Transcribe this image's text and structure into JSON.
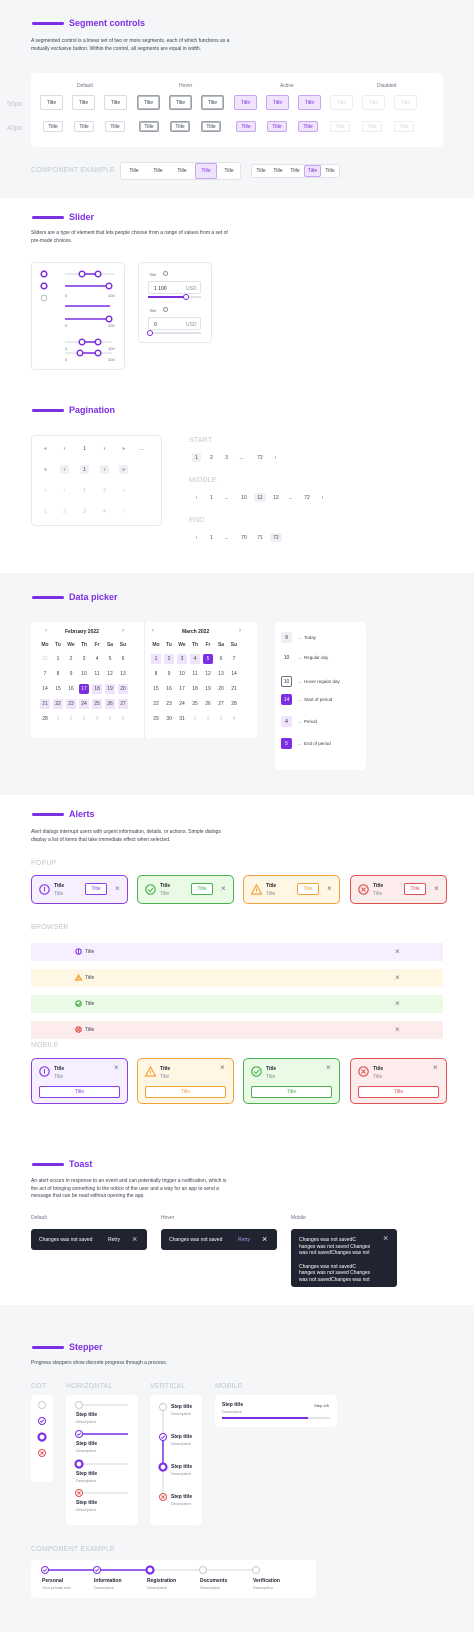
{
  "segment": {
    "title": "Segment controls",
    "desc": "A segmented control is a linear set of two or more segments, each of which functions as a mutually exclusive button. Within the control, all segments are equal in width.",
    "states": [
      "Default",
      "Hover",
      "Active",
      "Disabled"
    ],
    "sizes": [
      "56px",
      "40px"
    ],
    "item": "Title",
    "example_label": "COMPONENT EXAMPLE"
  },
  "slider": {
    "title": "Slider",
    "desc": "Sliders are a type of element that lets people choose from a range of values from a set of pre-made choices.",
    "min": "0",
    "max": "100",
    "field_label": "Title",
    "value1": "1 100",
    "value2": "0",
    "unit": "USD",
    "fill1": 0.72,
    "fill2": 0.0
  },
  "pagination": {
    "title": "Pagination",
    "first": "«",
    "prev": "‹",
    "next": "›",
    "last": "»",
    "dots": "…",
    "labels": [
      "START",
      "MIDDLE",
      "END"
    ],
    "start": [
      "1",
      "2",
      "3",
      "...",
      "72"
    ],
    "middle": [
      "1",
      "...",
      "10",
      "11",
      "12",
      "...",
      "72"
    ],
    "end": [
      "1",
      "...",
      "70",
      "71",
      "72"
    ],
    "card_rows": [
      [
        "1"
      ],
      [
        "1"
      ],
      [
        "1",
        "2",
        "3",
        "4"
      ],
      [
        "1",
        "2",
        "3",
        "4"
      ]
    ]
  },
  "datepicker": {
    "title": "Data picker",
    "month1": "February 2022",
    "month2": "March 2022",
    "weekdays": [
      "Mo",
      "Tu",
      "We",
      "Th",
      "Fr",
      "Sa",
      "Su"
    ],
    "feb": [
      [
        "31",
        "1",
        "2",
        "3",
        "4",
        "5",
        "6"
      ],
      [
        "7",
        "8",
        "9",
        "10",
        "11",
        "12",
        "13"
      ],
      [
        "14",
        "15",
        "16",
        "17",
        "18",
        "19",
        "20"
      ],
      [
        "21",
        "22",
        "23",
        "24",
        "25",
        "26",
        "27"
      ],
      [
        "28",
        "1",
        "2",
        "3",
        "4",
        "5",
        "6"
      ]
    ],
    "mar": [
      [
        "1",
        "2",
        "3",
        "4",
        "5",
        "6",
        "7"
      ],
      [
        "8",
        "9",
        "10",
        "11",
        "12",
        "13",
        "14"
      ],
      [
        "15",
        "16",
        "17",
        "18",
        "19",
        "20",
        "21"
      ],
      [
        "22",
        "23",
        "24",
        "25",
        "26",
        "27",
        "28"
      ],
      [
        "29",
        "30",
        "31",
        "1",
        "2",
        "3",
        "4"
      ]
    ],
    "legend": [
      {
        "num": "9",
        "text": "Today"
      },
      {
        "num": "10",
        "text": "Regular day"
      },
      {
        "num": "10",
        "text": "Hover regular day"
      },
      {
        "num": "14",
        "text": "Start of period"
      },
      {
        "num": "4",
        "text": "Period"
      },
      {
        "num": "5",
        "text": "End of period"
      }
    ]
  },
  "alerts": {
    "title": "Alerts",
    "desc": "Alert dialogs interrupt users with urgent information, details, or actions. Simple dialogs display a list of items that take immediate effect when selected.",
    "groups": [
      "POPUP",
      "BROWSER",
      "MOBILE"
    ],
    "item_title": "Title",
    "item_sub": "Title",
    "btn": "Title",
    "colors": {
      "purple": "#8b3fe6",
      "green": "#4cb050",
      "orange": "#f0a33a",
      "red": "#e05252"
    }
  },
  "toast": {
    "title": "Toast",
    "desc": "An alert occurs in response to an event and can potentially trigger a notification, which is the act of bringing something to the notice of the user and a way for an app to send a message that can be read without opening the app.",
    "states": [
      "Default",
      "Hover",
      "Mobile"
    ],
    "message": "Changes was not saved",
    "retry": "Retry",
    "mobile_lines": [
      "Changes was not savedC",
      "hanges was not saved Changes",
      "was not savedChanges was not"
    ]
  },
  "stepper": {
    "title": "Stepper",
    "desc": "Progress steppers show discrete progress through a process.",
    "groups": [
      "DOT",
      "HORIZONTAL",
      "VERTICAL",
      "MOBILE"
    ],
    "step": "Step title",
    "step_desc": "Description",
    "mobile_count": "Step 4/5",
    "example_label": "COMPONENT EXAMPLE",
    "example_steps": [
      {
        "title": "Personal",
        "desc": "Your private info"
      },
      {
        "title": "Information",
        "desc": "Description"
      },
      {
        "title": "Registration",
        "desc": "Description"
      },
      {
        "title": "Documents",
        "desc": "Description"
      },
      {
        "title": "Verification",
        "desc": "Description"
      }
    ],
    "mobile_progress": 0.8
  }
}
